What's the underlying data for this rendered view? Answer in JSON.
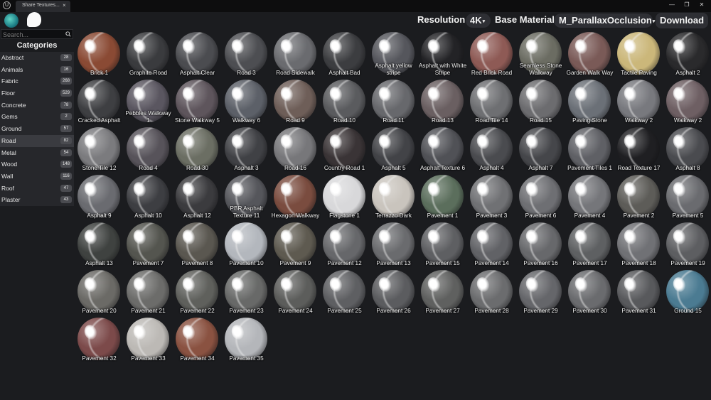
{
  "window": {
    "tab_title": "Share Textures...",
    "close_glyph": "×",
    "controls": [
      "—",
      "❐",
      "✕"
    ]
  },
  "header": {
    "resolution_label": "Resolution",
    "resolution_value": "4K",
    "base_material_label": "Base Material",
    "base_material_value": "M_ParallaxOcclusion",
    "download_label": "Download"
  },
  "search": {
    "placeholder": "Search..."
  },
  "categories": {
    "heading": "Categories",
    "active": "Road",
    "items": [
      {
        "label": "Abstract",
        "count": "28"
      },
      {
        "label": "Animals",
        "count": "16"
      },
      {
        "label": "Fabric",
        "count": "268"
      },
      {
        "label": "Floor",
        "count": "529"
      },
      {
        "label": "Concrete",
        "count": "78"
      },
      {
        "label": "Gems",
        "count": "2"
      },
      {
        "label": "Ground",
        "count": "57"
      },
      {
        "label": "Road",
        "count": "82"
      },
      {
        "label": "Metal",
        "count": "54"
      },
      {
        "label": "Wood",
        "count": "148"
      },
      {
        "label": "Wall",
        "count": "116"
      },
      {
        "label": "Roof",
        "count": "47"
      },
      {
        "label": "Plaster",
        "count": "43"
      }
    ]
  },
  "materials": [
    {
      "name": "Brick 1",
      "color": "#8a4a34"
    },
    {
      "name": "Graphite Road",
      "color": "#3a3b3e"
    },
    {
      "name": "Asphalt Clear",
      "color": "#4b4c50"
    },
    {
      "name": "Road 3",
      "color": "#4d4e52"
    },
    {
      "name": "Road Sidewalk",
      "color": "#6a6b6f"
    },
    {
      "name": "Asphalt Bad",
      "color": "#3c3d40"
    },
    {
      "name": "Asphalt yellow stripe",
      "color": "#55565c"
    },
    {
      "name": "Asphalt with White Stripe",
      "color": "#232326"
    },
    {
      "name": "Red Brick Road",
      "color": "#8e5a55"
    },
    {
      "name": "Seamless Stone Walkway",
      "color": "#6b6c62"
    },
    {
      "name": "Garden Walk Way",
      "color": "#7a5a57"
    },
    {
      "name": "Tactile Paving",
      "color": "#cbb77a"
    },
    {
      "name": "Asphalt 2",
      "color": "#2a2a2c"
    },
    {
      "name": "Cracked Asphalt",
      "color": "#3e3f42"
    },
    {
      "name": "Pebbles Walkway 1",
      "color": "#5a5660"
    },
    {
      "name": "Stone Walkway 5",
      "color": "#5e555c"
    },
    {
      "name": "Walkway 6",
      "color": "#5c6068"
    },
    {
      "name": "Road 9",
      "color": "#6e5e58"
    },
    {
      "name": "Road 10",
      "color": "#5a5b5e"
    },
    {
      "name": "Road 11",
      "color": "#67686c"
    },
    {
      "name": "Road 13",
      "color": "#6a5f61"
    },
    {
      "name": "Road Tile 14",
      "color": "#6e6f72"
    },
    {
      "name": "Road 15",
      "color": "#6c6c6f"
    },
    {
      "name": "Paving Stone",
      "color": "#6b7077"
    },
    {
      "name": "Walkway 2",
      "color": "#78797e"
    },
    {
      "name": "Walkway 2",
      "color": "#6e5f63"
    },
    {
      "name": "Stone Tile 12",
      "color": "#7b7b7e"
    },
    {
      "name": "Road 4",
      "color": "#57535a"
    },
    {
      "name": "Road 30",
      "color": "#6b6e63"
    },
    {
      "name": "Asphalt 3",
      "color": "#404145"
    },
    {
      "name": "Road 16",
      "color": "#77777a"
    },
    {
      "name": "Country Road 1",
      "color": "#3a3436"
    },
    {
      "name": "Asphalt 5",
      "color": "#424347"
    },
    {
      "name": "Asphalt Texture 6",
      "color": "#505156"
    },
    {
      "name": "Asphalt 4",
      "color": "#4a4b4f"
    },
    {
      "name": "Asphalt 7",
      "color": "#45464a"
    },
    {
      "name": "Pavement Tiles 1",
      "color": "#5f6065"
    },
    {
      "name": "Road Texture 17",
      "color": "#1f1f22"
    },
    {
      "name": "Asphalt 8",
      "color": "#4a4b4f"
    },
    {
      "name": "Asphalt 9",
      "color": "#6a6b70"
    },
    {
      "name": "Asphalt 10",
      "color": "#3d3e42"
    },
    {
      "name": "Asphalt 12",
      "color": "#3b3b3e"
    },
    {
      "name": "PBR Asphalt Texture 11",
      "color": "#55565b"
    },
    {
      "name": "Hexagon Walkway",
      "color": "#7a4c3f"
    },
    {
      "name": "Flagstone 1",
      "color": "#d8d8da"
    },
    {
      "name": "Terrazzo Dark",
      "color": "#c9c4bd"
    },
    {
      "name": "Pavement 1",
      "color": "#5b6e5c"
    },
    {
      "name": "Pavement 3",
      "color": "#707174"
    },
    {
      "name": "Pavement 6",
      "color": "#6e6f73"
    },
    {
      "name": "Pavement 4",
      "color": "#75767a"
    },
    {
      "name": "Pavement 2",
      "color": "#5d5c58"
    },
    {
      "name": "Pavement 5",
      "color": "#6a6b6f"
    },
    {
      "name": "Asphalt 13",
      "color": "#3f4240"
    },
    {
      "name": "Pavement 7",
      "color": "#54554f"
    },
    {
      "name": "Pavement 8",
      "color": "#5a5750"
    },
    {
      "name": "Pavement 10",
      "color": "#b3b7bd"
    },
    {
      "name": "Pavement 9",
      "color": "#5e5a50"
    },
    {
      "name": "Pavement 12",
      "color": "#66676a"
    },
    {
      "name": "Pavement 13",
      "color": "#6a6b6e"
    },
    {
      "name": "Pavement 15",
      "color": "#5e5f62"
    },
    {
      "name": "Pavement 14",
      "color": "#616266"
    },
    {
      "name": "Pavement 16",
      "color": "#67686b"
    },
    {
      "name": "Pavement 17",
      "color": "#5e6062"
    },
    {
      "name": "Pavement 18",
      "color": "#707175"
    },
    {
      "name": "Pavement 19",
      "color": "#5d5e61"
    },
    {
      "name": "Pavement 20",
      "color": "#6b6a66"
    },
    {
      "name": "Pavement 21",
      "color": "#6c6c6a"
    },
    {
      "name": "Pavement 22",
      "color": "#5f605c"
    },
    {
      "name": "Pavement 23",
      "color": "#686968"
    },
    {
      "name": "Pavement 24",
      "color": "#5c5d5b"
    },
    {
      "name": "Pavement 25",
      "color": "#5e5f62"
    },
    {
      "name": "Pavement 26",
      "color": "#5b5c5f"
    },
    {
      "name": "Pavement 27",
      "color": "#5f605f"
    },
    {
      "name": "Pavement 28",
      "color": "#6b6c6e"
    },
    {
      "name": "Pavement 29",
      "color": "#65666a"
    },
    {
      "name": "Pavement 30",
      "color": "#6a6b6e"
    },
    {
      "name": "Pavement 31",
      "color": "#58595c"
    },
    {
      "name": "Ground 15",
      "color": "#4b7b92"
    },
    {
      "name": "Pavement 32",
      "color": "#7c4a4a"
    },
    {
      "name": "Pavement 33",
      "color": "#bcb9b5"
    },
    {
      "name": "Pavement 34",
      "color": "#8a5241"
    },
    {
      "name": "Pavement 35",
      "color": "#b4b6ba"
    }
  ]
}
